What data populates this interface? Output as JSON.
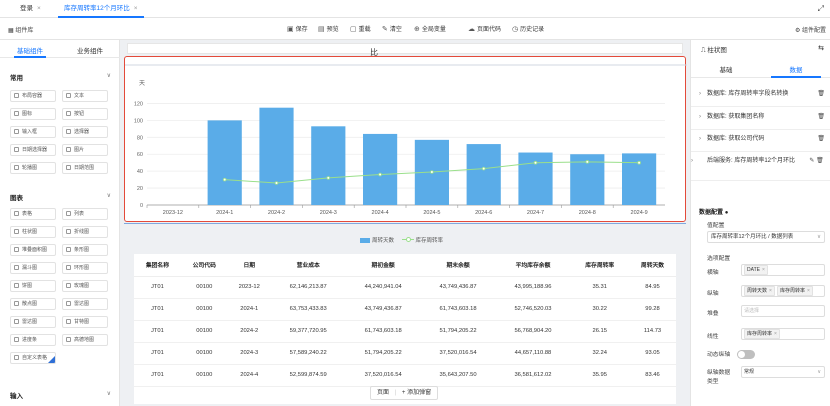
{
  "tabs": [
    {
      "label": "登录"
    },
    {
      "label": "库存周转率12个月环比"
    }
  ],
  "toolbar": {
    "left_label": "组件库",
    "right_label": "组件配置",
    "buttons": [
      {
        "icon": "save-icon",
        "label": "保存"
      },
      {
        "icon": "preview-icon",
        "label": "预览"
      },
      {
        "icon": "reload-icon",
        "label": "重载"
      },
      {
        "icon": "clear-icon",
        "label": "清空"
      },
      {
        "icon": "variable-icon",
        "label": "全局变量"
      },
      {
        "icon": "code-icon",
        "label": "页面代码"
      },
      {
        "icon": "history-icon",
        "label": "历史记录"
      }
    ]
  },
  "left_panel": {
    "tabs": [
      "基础组件",
      "业务组件"
    ],
    "sections": [
      {
        "title": "常用",
        "items": [
          "布局容器",
          "文本",
          "图标",
          "按钮",
          "输入框",
          "选择器",
          "日期选择器",
          "图片",
          "轮播图",
          "日期范围"
        ]
      },
      {
        "title": "图表",
        "items": [
          "表格",
          "列表",
          "柱状图",
          "折线图",
          "堆叠面积图",
          "条形图",
          "漏斗图",
          "环形图",
          "饼图",
          "玫瑰图",
          "散点图",
          "雷达图",
          "雷达图",
          "甘特图",
          "进度条",
          "高德地图",
          "自定义表格"
        ]
      },
      {
        "title": "输入",
        "items": []
      }
    ]
  },
  "canvas": {
    "top_strip_label": "比",
    "page_label": "页面",
    "add_popup_label": "+ 添加弹窗"
  },
  "chart_data": {
    "type": "bar",
    "ylabel": "天",
    "ylim": [
      0,
      130
    ],
    "yticks": [
      0,
      20,
      40,
      60,
      80,
      100,
      120
    ],
    "categories": [
      "2023-12",
      "2024-1",
      "2024-2",
      "2024-3",
      "2024-4",
      "2024-5",
      "2024-6",
      "2024-7",
      "2024-8",
      "2024-9"
    ],
    "series": [
      {
        "name": "周转天数",
        "type": "bar",
        "color": "#5aace8",
        "values": [
          null,
          100,
          115,
          93,
          84,
          77,
          72,
          62,
          60,
          61
        ]
      },
      {
        "name": "库存周转率",
        "type": "line",
        "color": "#9adf8b",
        "values": [
          null,
          30,
          26,
          32,
          36,
          39,
          43,
          50,
          51,
          50
        ]
      }
    ],
    "legend_position": "bottom",
    "grid": true
  },
  "table": {
    "columns": [
      "集团名称",
      "公司代码",
      "日期",
      "营业成本",
      "期初金额",
      "期末余额",
      "平均库存余额",
      "库存周转率",
      "周转天数"
    ],
    "rows": [
      [
        "JT01",
        "00100",
        "2023-12",
        "62,146,213.87",
        "44,240,941.04",
        "43,749,436.87",
        "43,995,188.96",
        "35.31",
        "84.95"
      ],
      [
        "JT01",
        "00100",
        "2024-1",
        "63,753,433.83",
        "43,749,436.87",
        "61,743,603.18",
        "52,746,520.03",
        "30.22",
        "99.28"
      ],
      [
        "JT01",
        "00100",
        "2024-2",
        "59,377,720.95",
        "61,743,603.18",
        "51,794,205.22",
        "56,768,904.20",
        "26.15",
        "114.73"
      ],
      [
        "JT01",
        "00100",
        "2024-3",
        "57,589,240.22",
        "51,794,205.22",
        "37,520,016.54",
        "44,657,110.88",
        "32.24",
        "93.05"
      ],
      [
        "JT01",
        "00100",
        "2024-4",
        "52,599,874.59",
        "37,520,016.54",
        "35,643,207.50",
        "36,581,612.02",
        "35.95",
        "83.46"
      ]
    ]
  },
  "right_panel": {
    "title": "柱状图",
    "tabs": [
      "基础",
      "数据"
    ],
    "datasources": [
      "数据库: 库存周转率字段名转换",
      "数据库: 获取集团名称",
      "数据库: 获取公司代码",
      "后端服务: 库存周转率12个月环比"
    ],
    "config_title": "数据配置",
    "value_config_label": "值配置",
    "value_config_select": "库存周转率12个月环比 / 数据列表",
    "series_config_label": "选项配置",
    "x_axis_label": "横轴",
    "x_axis_chips": [
      "DATE"
    ],
    "y_axis_label": "纵轴",
    "y_axis_chips": [
      "周转天数",
      "库存周转率"
    ],
    "stack_label": "堆叠",
    "stack_placeholder": "请选择",
    "line_label": "线性",
    "line_chips": [
      "库存周转率"
    ],
    "dynamic_y_label": "动态纵轴",
    "y_type_label_1": "纵轴数据",
    "y_type_label_2": "类型",
    "y_type_value": "常规"
  }
}
